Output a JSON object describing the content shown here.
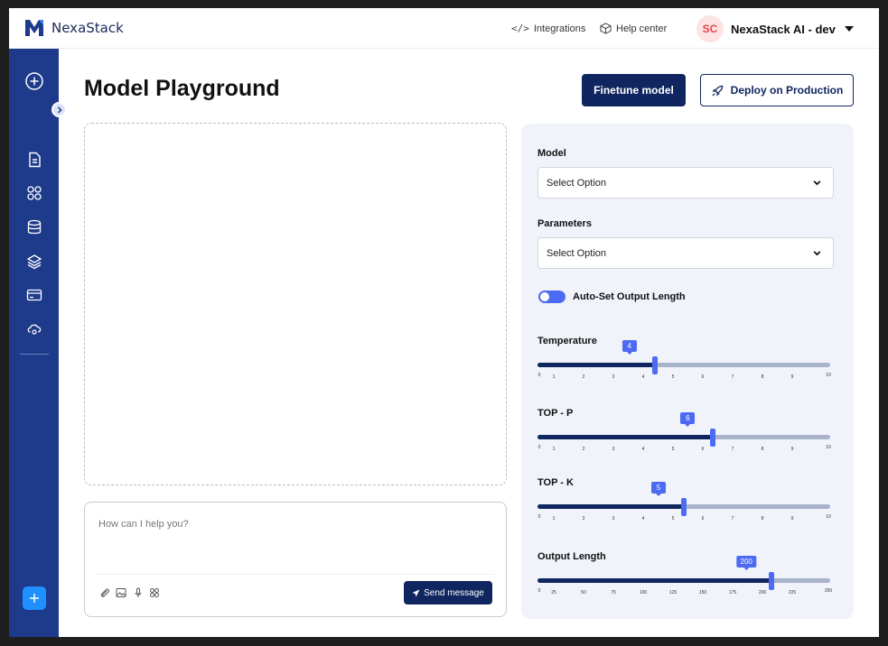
{
  "brand": {
    "name": "NexaStack",
    "color": "#1e3a8a"
  },
  "topbar": {
    "integrations_label": "Integrations",
    "help_label": "Help center",
    "avatar_initials": "SC",
    "org_name": "NexaStack AI - dev"
  },
  "sidebar": {
    "items": [
      "plus-circle-icon",
      "document-icon",
      "apps-icon",
      "database-icon",
      "layers-icon",
      "card-icon",
      "cloud-settings-icon"
    ]
  },
  "page": {
    "title": "Model Playground",
    "finetune_label": "Finetune model",
    "deploy_label": "Deploy on Production"
  },
  "composer": {
    "placeholder": "How can I help you?",
    "send_label": "Send message"
  },
  "settings": {
    "model_label": "Model",
    "model_value": "Select Option",
    "parameters_label": "Parameters",
    "parameters_value": "Select Option",
    "auto_output_label": "Auto-Set Output Length",
    "auto_output_enabled": false,
    "sliders": [
      {
        "key": "temperature",
        "label": "Temperature",
        "value": "4",
        "min": 0,
        "max": 10,
        "fraction": 0.4,
        "ticks": [
          "0",
          "1",
          "2",
          "3",
          "4",
          "5",
          "6",
          "7",
          "8",
          "9",
          "10"
        ]
      },
      {
        "key": "top_p",
        "label": "TOP - P",
        "value": "6",
        "min": 0,
        "max": 10,
        "fraction": 0.6,
        "ticks": [
          "0",
          "1",
          "2",
          "3",
          "4",
          "5",
          "6",
          "7",
          "8",
          "9",
          "10"
        ]
      },
      {
        "key": "top_k",
        "label": "TOP - K",
        "value": "5",
        "min": 0,
        "max": 10,
        "fraction": 0.5,
        "ticks": [
          "0",
          "1",
          "2",
          "3",
          "4",
          "5",
          "6",
          "7",
          "8",
          "9",
          "10"
        ]
      },
      {
        "key": "output_length",
        "label": "Output Length",
        "value": "200",
        "min": 0,
        "max": 250,
        "fraction": 0.8,
        "ticks": [
          "0",
          "25",
          "50",
          "75",
          "100",
          "125",
          "150",
          "175",
          "200",
          "225",
          "250"
        ]
      }
    ]
  }
}
